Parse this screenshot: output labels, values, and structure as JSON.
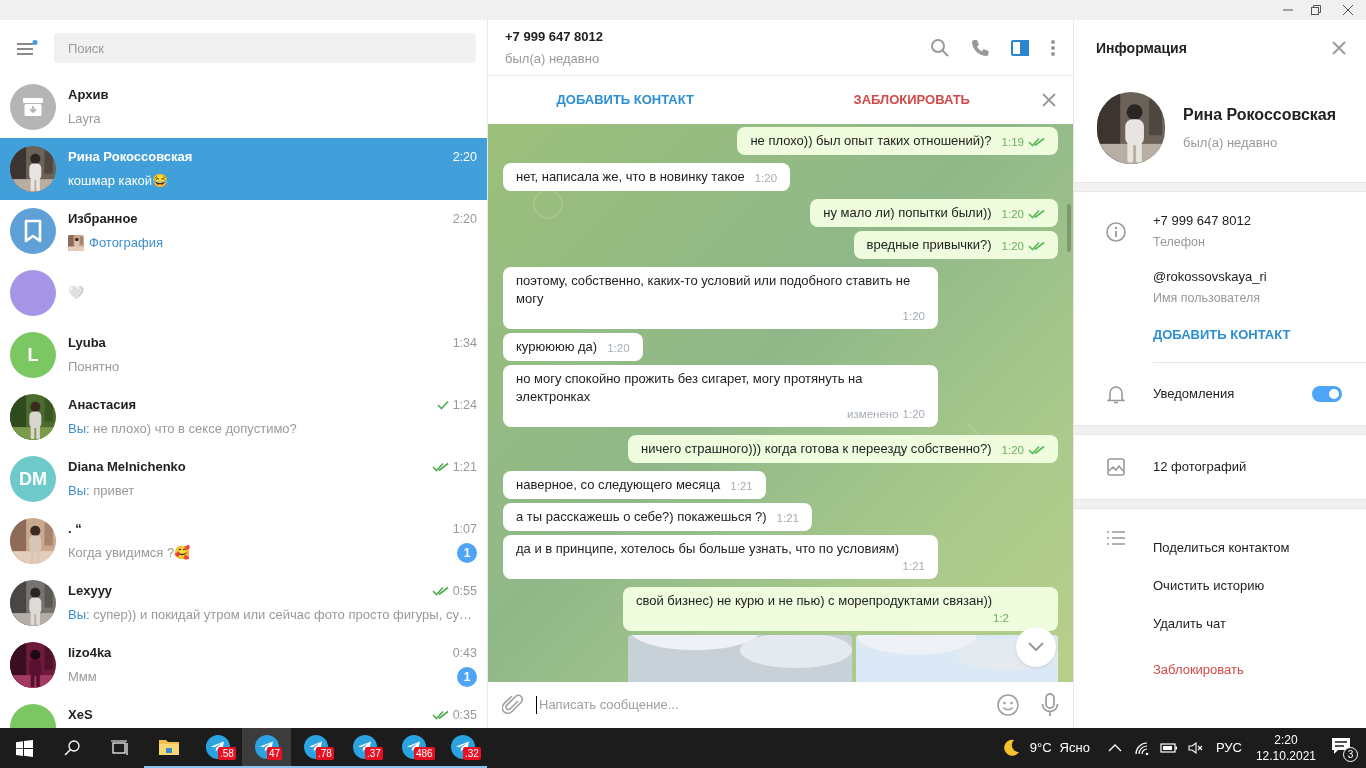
{
  "sidebar": {
    "search": {
      "placeholder": "Поиск"
    },
    "chats": [
      {
        "name": "Архив",
        "preview": "Layra",
        "avatar": {
          "kind": "archive"
        },
        "selected": false
      },
      {
        "name": "Рина Рокоссовская",
        "time": "2:20",
        "preview": "кошмар какой😂",
        "selected": true
      },
      {
        "name": "Избранное",
        "time": "2:20",
        "preview": "Фотография",
        "avatar": {
          "kind": "saved"
        },
        "selected": false
      },
      {
        "preview": "🤍",
        "avatar": {
          "kind": "plain",
          "color": "#a695e7"
        },
        "selected": false
      },
      {
        "name": "Lyuba",
        "time": "1:34",
        "preview": "Понятно",
        "avatar": {
          "kind": "initials",
          "initials": "L",
          "color": "#7bc862"
        },
        "selected": false
      },
      {
        "name": "Анастасия",
        "time": "1:24",
        "sent": true,
        "read": false,
        "sender": "Вы:",
        "preview": "не плохо) что в сексе допустимо?",
        "selected": false
      },
      {
        "name": "Diana Melnichenko",
        "time": "1:21",
        "sent": true,
        "read": true,
        "sender": "Вы:",
        "preview": "привет",
        "avatar": {
          "kind": "initials",
          "initials": "DM",
          "color": "#6ec9cb"
        },
        "selected": false
      },
      {
        "name": ". “",
        "time": "1:07",
        "preview": "Когда увидимся ?🥰",
        "unread": "1",
        "selected": false
      },
      {
        "name": "Lexyyy",
        "time": "0:55",
        "sent": true,
        "read": true,
        "sender": "Вы:",
        "preview": "супер)) и покидай утром или сейчас фото просто фигуры, су…",
        "selected": false
      },
      {
        "name": "lizo4ka",
        "time": "0:43",
        "preview": "Ммм",
        "unread": "1",
        "selected": false
      },
      {
        "name": "XeS",
        "time": "0:35",
        "sent": true,
        "read": true,
        "avatar": {
          "kind": "plain",
          "color": "#7bc862"
        },
        "selected": false
      }
    ]
  },
  "chat": {
    "title": "+7 999 647 8012",
    "status": "был(а) недавно",
    "side_panel_active": true,
    "action_bar": {
      "add": "ДОБАВИТЬ КОНТАКТ",
      "block": "ЗАБЛОКИРОВАТЬ"
    },
    "messages": [
      {
        "kind": "out",
        "text": "не плохо)) был опыт таких отношений)?",
        "time": "1:19",
        "read": true
      },
      {
        "kind": "in",
        "text": "нет, написала же, что в новинку такое",
        "time": "1:20"
      },
      {
        "kind": "out",
        "text": "ну мало ли) попытки были))",
        "time": "1:20",
        "read": true
      },
      {
        "kind": "out",
        "text": "вредные привычки?)",
        "time": "1:20",
        "read": true
      },
      {
        "kind": "in",
        "text": "поэтому, собственно, каких-то условий или подобного ставить не могу",
        "time": "1:20"
      },
      {
        "kind": "in",
        "text": "курюююю да)",
        "time": "1:20"
      },
      {
        "kind": "in",
        "text": "но могу спокойно прожить без сигарет, могу протянуть на электронках",
        "edited": "изменено",
        "time": "1:20"
      },
      {
        "kind": "out",
        "text": "ничего страшного))) когда готова к переезду собственно?)",
        "time": "1:20",
        "read": true
      },
      {
        "kind": "in",
        "text": "наверное, со следующего месяца",
        "time": "1:21"
      },
      {
        "kind": "in",
        "text": "а ты расскажешь о себе?) покажешься ?)",
        "time": "1:21"
      },
      {
        "kind": "in",
        "text": "да и в принципе, хотелось бы больше узнать, что по условиям)",
        "time": "1:21"
      },
      {
        "kind": "out",
        "text": "свой бизнес) не курю и не пью) с морепродуктами связан))",
        "time": "1:2"
      },
      {
        "kind": "album"
      }
    ],
    "composer": {
      "placeholder": "Написать сообщение..."
    }
  },
  "info": {
    "title": "Информация",
    "name": "Рина Рокоссовская",
    "status": "был(а) недавно",
    "rows": [
      {
        "value": "+7 999 647 8012",
        "label": "Телефон"
      },
      {
        "value": "@rokossovskaya_ri",
        "label": "Имя пользователя"
      }
    ],
    "add_contact": "ДОБАВИТЬ КОНТАКТ",
    "notifications": {
      "label": "Уведомления",
      "on": true
    },
    "photos": "12 фотографий",
    "actions": [
      {
        "label": "Поделиться контактом",
        "danger": false
      },
      {
        "label": "Очистить историю",
        "danger": false
      },
      {
        "label": "Удалить чат",
        "danger": false
      },
      {
        "label": "Заблокировать",
        "danger": true
      }
    ]
  },
  "taskbar": {
    "apps": [
      {
        "kind": "explorer",
        "selected": false
      },
      {
        "kind": "telegram",
        "badge": ".58",
        "selected": false
      },
      {
        "kind": "telegram",
        "badge": "47",
        "selected": true
      },
      {
        "kind": "telegram",
        "badge": ".78",
        "selected": false
      },
      {
        "kind": "telegram",
        "badge": ".37",
        "selected": false
      },
      {
        "kind": "telegram",
        "badge": "486",
        "selected": false
      },
      {
        "kind": "telegram",
        "badge": ".32",
        "selected": false
      }
    ],
    "weather": {
      "temp": "9°C",
      "text": "Ясно"
    },
    "language": "РУС",
    "time": "2:20",
    "date": "12.10.2021",
    "notifications": "3"
  }
}
